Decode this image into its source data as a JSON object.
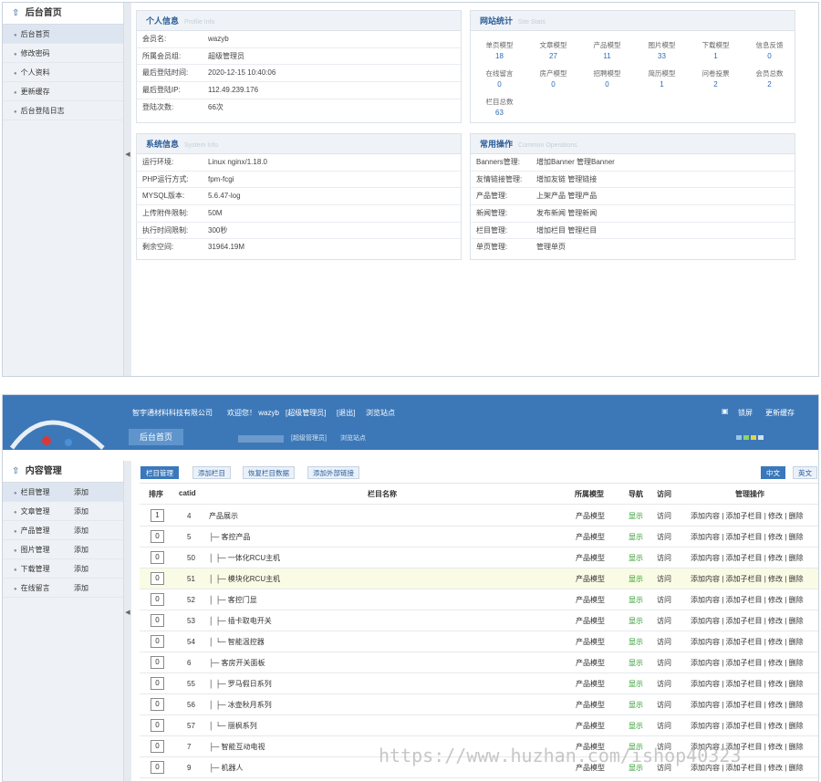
{
  "panel1": {
    "sidebar": {
      "title": "后台首页",
      "items": [
        "后台首页",
        "修改密码",
        "个人资料",
        "更新缓存",
        "后台登陆日志"
      ]
    },
    "profile": {
      "title": "个人信息",
      "title_en": "Profile  Info",
      "rows": [
        {
          "k": "会员名:",
          "v": "wazyb"
        },
        {
          "k": "所属会员组:",
          "v": "超级管理员"
        },
        {
          "k": "最后登陆时间:",
          "v": "2020-12-15 10:40:06"
        },
        {
          "k": "最后登陆IP:",
          "v": "112.49.239.176"
        },
        {
          "k": "登陆次数:",
          "v": "66次"
        }
      ]
    },
    "stats": {
      "title": "网站统计",
      "title_en": "Site  Stats",
      "items": [
        {
          "label": "单页模型",
          "value": "18"
        },
        {
          "label": "文章模型",
          "value": "27"
        },
        {
          "label": "产品模型",
          "value": "11"
        },
        {
          "label": "图片模型",
          "value": "33"
        },
        {
          "label": "下载模型",
          "value": "1"
        },
        {
          "label": "信息反馈",
          "value": "0"
        },
        {
          "label": "在线留言",
          "value": "0"
        },
        {
          "label": "房产模型",
          "value": "0"
        },
        {
          "label": "招聘模型",
          "value": "0"
        },
        {
          "label": "简历模型",
          "value": "1"
        },
        {
          "label": "问卷投票",
          "value": "2"
        },
        {
          "label": "会员总数",
          "value": "2"
        },
        {
          "label": "栏目总数",
          "value": "63"
        }
      ]
    },
    "system": {
      "title": "系统信息",
      "title_en": "System  Info",
      "rows": [
        {
          "k": "运行环境:",
          "v": "Linux nginx/1.18.0"
        },
        {
          "k": "PHP运行方式:",
          "v": "fpm-fcgi"
        },
        {
          "k": "MYSQL版本:",
          "v": "5.6.47-log"
        },
        {
          "k": "上传附件限制:",
          "v": "50M"
        },
        {
          "k": "执行时间限制:",
          "v": "300秒"
        },
        {
          "k": "剩余空间:",
          "v": "31964.19M"
        }
      ]
    },
    "ops": {
      "title": "常用操作",
      "title_en": "Common  Operations",
      "rows": [
        {
          "k": "Banners管理:",
          "v": "增加Banner  管理Banner"
        },
        {
          "k": "友情链接管理:",
          "v": "增加友链  管理链接"
        },
        {
          "k": "产品管理:",
          "v": "上架产品  管理产品"
        },
        {
          "k": "新闻管理:",
          "v": "发布新闻  管理新闻"
        },
        {
          "k": "栏目管理:",
          "v": "增加栏目  管理栏目"
        },
        {
          "k": "单页管理:",
          "v": "管理单页"
        }
      ]
    }
  },
  "panel2": {
    "header": {
      "company": "智宇通材料科技有限公司",
      "welcome": "欢迎您！ wazyb",
      "role": "[超级管理员]",
      "logout": "[退出]",
      "browse": "浏览站点",
      "lock": "锁屏",
      "refresh": "更新缓存",
      "home_tab": "后台首页",
      "sub_role": "[超级管理员]",
      "sub_browse": "浏览站点"
    },
    "sidebar": {
      "title": "内容管理",
      "items": [
        {
          "label": "栏目管理",
          "add": "添加"
        },
        {
          "label": "文章管理",
          "add": "添加"
        },
        {
          "label": "产品管理",
          "add": "添加"
        },
        {
          "label": "图片管理",
          "add": "添加"
        },
        {
          "label": "下载管理",
          "add": "添加"
        },
        {
          "label": "在线留言",
          "add": "添加"
        }
      ]
    },
    "toolbar": {
      "buttons": [
        "栏目管理",
        "添加栏目",
        "恢复栏目数据",
        "添加外部链接"
      ],
      "lang_cn": "中文",
      "lang_en": "英文"
    },
    "table": {
      "headers": [
        "排序",
        "catid",
        "栏目名称",
        "所属模型",
        "导航",
        "访问",
        "管理操作"
      ],
      "ops": "添加内容 | 添加子栏目 | 修改 | 删除",
      "rows": [
        {
          "order": "1",
          "catid": "4",
          "name": "产品展示",
          "model": "产品模型",
          "nav": "显示",
          "visit": "访问"
        },
        {
          "order": "0",
          "catid": "5",
          "name": "├─ 客控产品",
          "model": "产品模型",
          "nav": "显示",
          "visit": "访问"
        },
        {
          "order": "0",
          "catid": "50",
          "name": "│      ├─ 一体化RCU主机",
          "model": "产品模型",
          "nav": "显示",
          "visit": "访问"
        },
        {
          "order": "0",
          "catid": "51",
          "name": "│      ├─ 模块化RCU主机",
          "model": "产品模型",
          "nav": "显示",
          "visit": "访问"
        },
        {
          "order": "0",
          "catid": "52",
          "name": "│      ├─ 客控门显",
          "model": "产品模型",
          "nav": "显示",
          "visit": "访问"
        },
        {
          "order": "0",
          "catid": "53",
          "name": "│      ├─ 插卡取电开关",
          "model": "产品模型",
          "nav": "显示",
          "visit": "访问"
        },
        {
          "order": "0",
          "catid": "54",
          "name": "│      └─ 智能温控器",
          "model": "产品模型",
          "nav": "显示",
          "visit": "访问"
        },
        {
          "order": "0",
          "catid": "6",
          "name": "├─ 客房开关面板",
          "model": "产品模型",
          "nav": "显示",
          "visit": "访问"
        },
        {
          "order": "0",
          "catid": "55",
          "name": "│      ├─ 罗马假日系列",
          "model": "产品模型",
          "nav": "显示",
          "visit": "访问"
        },
        {
          "order": "0",
          "catid": "56",
          "name": "│      ├─ 冰壶秋月系列",
          "model": "产品模型",
          "nav": "显示",
          "visit": "访问"
        },
        {
          "order": "0",
          "catid": "57",
          "name": "│      └─ 丽枫系列",
          "model": "产品模型",
          "nav": "显示",
          "visit": "访问"
        },
        {
          "order": "0",
          "catid": "7",
          "name": "├─ 智能互动电视",
          "model": "产品模型",
          "nav": "显示",
          "visit": "访问"
        },
        {
          "order": "0",
          "catid": "9",
          "name": "├─ 机器人",
          "model": "产品模型",
          "nav": "显示",
          "visit": "访问"
        }
      ]
    }
  },
  "watermark": "https://www.huzhan.com/ishop40323",
  "colors": {
    "accent": "#3c78b8",
    "link_green": "#2a9a2a",
    "stat_blue": "#2d6bb8"
  }
}
